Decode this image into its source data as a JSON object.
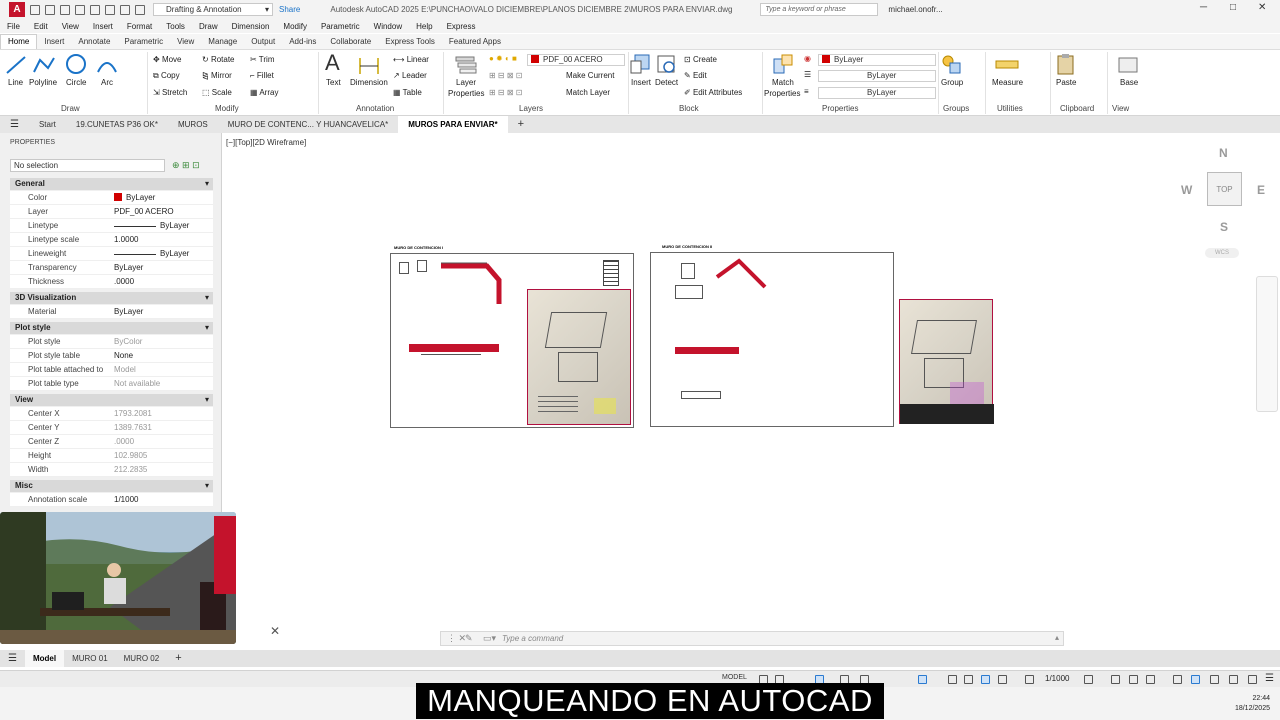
{
  "titlebar": {
    "app_letter": "A",
    "workspace": "Drafting & Annotation",
    "share": "Share",
    "title": "Autodesk AutoCAD 2025   E:\\PUNCHAO\\VALO DICIEMBRE\\PLANOS DICIEMBRE 2\\MUROS PARA ENVIAR.dwg",
    "search_placeholder": "Type a keyword or phrase",
    "user": "michael.onofr..."
  },
  "menu": [
    "File",
    "Edit",
    "View",
    "Insert",
    "Format",
    "Tools",
    "Draw",
    "Dimension",
    "Modify",
    "Parametric",
    "Window",
    "Help",
    "Express"
  ],
  "ribbon_tabs": [
    "Home",
    "Insert",
    "Annotate",
    "Parametric",
    "View",
    "Manage",
    "Output",
    "Add-ins",
    "Collaborate",
    "Express Tools",
    "Featured Apps"
  ],
  "ribbon": {
    "draw": {
      "line": "Line",
      "polyline": "Polyline",
      "circle": "Circle",
      "arc": "Arc",
      "label": "Draw"
    },
    "modify": {
      "move": "Move",
      "copy": "Copy",
      "stretch": "Stretch",
      "rotate": "Rotate",
      "mirror": "Mirror",
      "scale": "Scale",
      "trim": "Trim",
      "fillet": "Fillet",
      "array": "Array",
      "label": "Modify"
    },
    "annotation": {
      "text": "Text",
      "dimension": "Dimension",
      "linear": "Linear",
      "leader": "Leader",
      "table": "Table",
      "label": "Annotation"
    },
    "layers": {
      "layer_properties_1": "Layer",
      "layer_properties_2": "Properties",
      "current_layer": "PDF_00 ACERO",
      "make_current": "Make Current",
      "match_layer": "Match Layer",
      "label": "Layers"
    },
    "block": {
      "insert": "Insert",
      "detect": "Detect",
      "create": "Create",
      "edit": "Edit",
      "edit_attributes": "Edit Attributes",
      "label": "Block"
    },
    "properties": {
      "match_1": "Match",
      "match_2": "Properties",
      "color": "ByLayer",
      "linetype": "ByLayer",
      "lineweight": "ByLayer",
      "label": "Properties"
    },
    "groups": {
      "group": "Group",
      "label": "Groups"
    },
    "utilities": {
      "measure": "Measure",
      "label": "Utilities"
    },
    "clipboard": {
      "paste": "Paste",
      "label": "Clipboard"
    },
    "view": {
      "base": "Base",
      "label": "View"
    }
  },
  "file_tabs": [
    "Start",
    "19.CUNETAS P36 OK*",
    "MUROS",
    "MURO DE CONTENC... Y HUANCAVELICA*",
    "MUROS PARA ENVIAR*"
  ],
  "properties_palette": {
    "title": "PROPERTIES",
    "selection": "No selection",
    "sections": [
      {
        "name": "General",
        "rows": [
          {
            "k": "Color",
            "v": "ByLayer"
          },
          {
            "k": "Layer",
            "v": "PDF_00 ACERO"
          },
          {
            "k": "Linetype",
            "v": "ByLayer"
          },
          {
            "k": "Linetype scale",
            "v": "1.0000"
          },
          {
            "k": "Lineweight",
            "v": "ByLayer"
          },
          {
            "k": "Transparency",
            "v": "ByLayer"
          },
          {
            "k": "Thickness",
            "v": ".0000"
          }
        ]
      },
      {
        "name": "3D Visualization",
        "rows": [
          {
            "k": "Material",
            "v": "ByLayer"
          }
        ]
      },
      {
        "name": "Plot style",
        "rows": [
          {
            "k": "Plot style",
            "v": "ByColor"
          },
          {
            "k": "Plot style table",
            "v": "None"
          },
          {
            "k": "Plot table attached to",
            "v": "Model"
          },
          {
            "k": "Plot table type",
            "v": "Not available"
          }
        ]
      },
      {
        "name": "View",
        "rows": [
          {
            "k": "Center X",
            "v": "1793.2081"
          },
          {
            "k": "Center Y",
            "v": "1389.7631"
          },
          {
            "k": "Center Z",
            "v": ".0000"
          },
          {
            "k": "Height",
            "v": "102.9805"
          },
          {
            "k": "Width",
            "v": "212.2835"
          }
        ]
      },
      {
        "name": "Misc",
        "rows": [
          {
            "k": "Annotation scale",
            "v": "1/1000"
          }
        ]
      }
    ]
  },
  "viewport_label": "[−][Top][2D Wireframe]",
  "drawing": {
    "sheet1_title": "MURO DE CONTENCION I",
    "sheet2_title": "MURO DE CONTENCION II"
  },
  "viewcube": {
    "n": "N",
    "s": "S",
    "e": "E",
    "w": "W",
    "top": "TOP",
    "wcs": "WCS"
  },
  "command_placeholder": "Type a command",
  "layout_tabs": [
    "Model",
    "MURO 01",
    "MURO 02"
  ],
  "status": {
    "model": "MODEL",
    "scale": "1/1000"
  },
  "caption": "MANQUEANDO EN AUTOCAD",
  "clock": {
    "time": "22:44",
    "date": "18/12/2025"
  },
  "colors": {
    "accent": "#1a73c8",
    "layer_red": "#d10000",
    "brand": "#c4132c"
  }
}
